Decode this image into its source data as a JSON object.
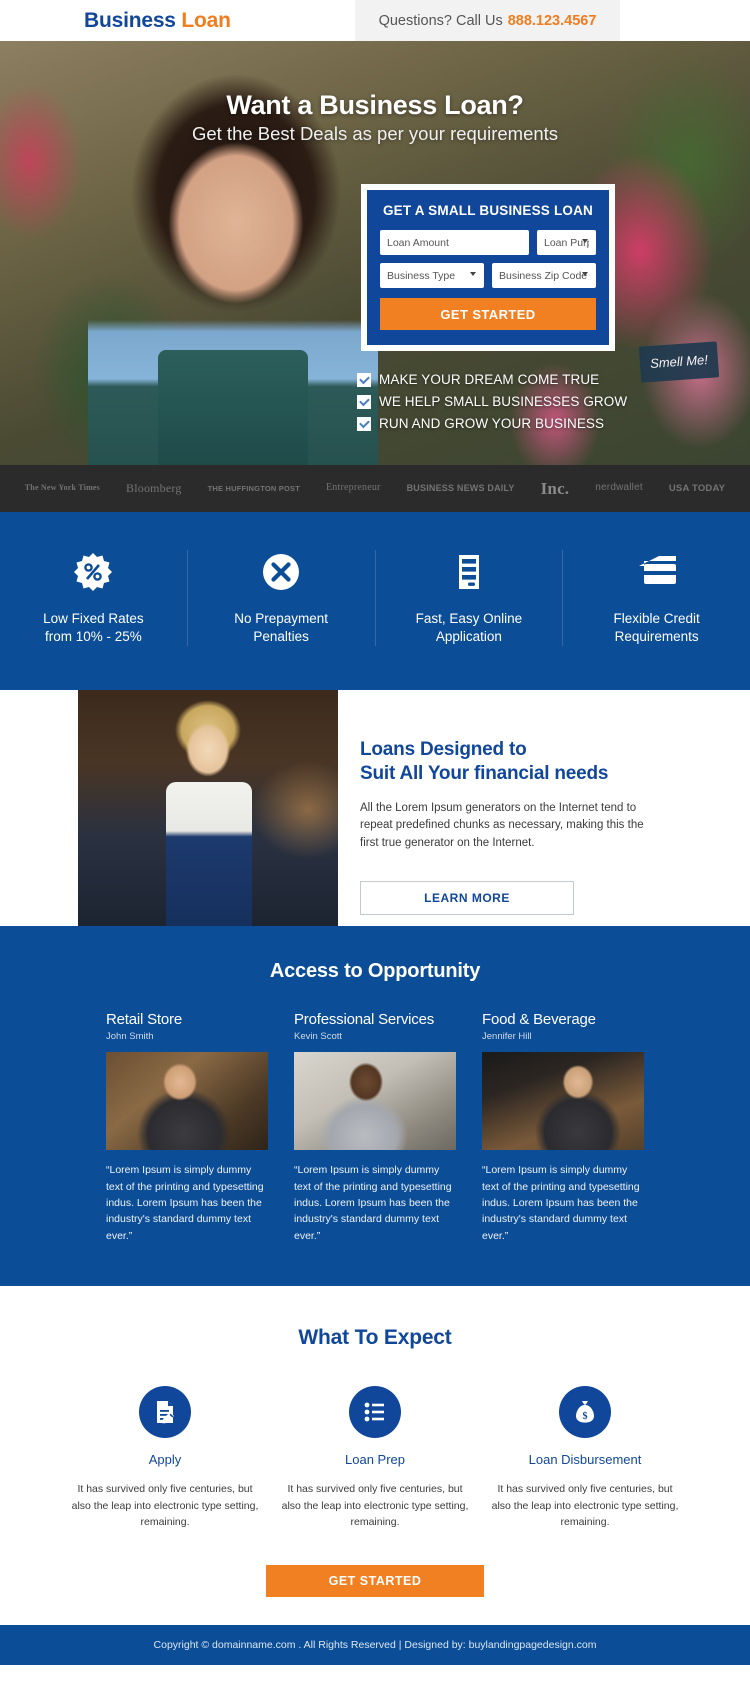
{
  "header": {
    "logo_primary": "Business",
    "logo_secondary": "Loan",
    "call_label": "Questions? Call Us",
    "phone": "888.123.4567"
  },
  "hero": {
    "title": "Want a Business Loan?",
    "subtitle": "Get the Best Deals as per your requirements",
    "sign_text": "Smell Me!",
    "form": {
      "title": "GET A SMALL BUSINESS LOAN",
      "loan_amount_placeholder": "Loan Amount",
      "loan_purpose_placeholder": "Loan Purpose",
      "business_type_placeholder": "Business Type",
      "zip_placeholder": "Business Zip Code",
      "submit_label": "GET STARTED"
    },
    "bullets": [
      "MAKE YOUR DREAM COME TRUE",
      "WE HELP SMALL BUSINESSES GROW",
      "RUN AND GROW YOUR BUSINESS"
    ]
  },
  "press": [
    "The New York Times",
    "Bloomberg",
    "THE HUFFINGTON POST",
    "Entrepreneur",
    "BUSINESS NEWS DAILY",
    "Inc.",
    "nerdwallet",
    "USA TODAY"
  ],
  "benefits": [
    {
      "icon": "percent-badge-icon",
      "label": "Low Fixed Rates\nfrom 10% - 25%",
      "line1": "Low Fixed Rates",
      "line2": "from 10% - 25%"
    },
    {
      "icon": "x-circle-icon",
      "label": "No Prepayment\nPenalties",
      "line1": "No Prepayment",
      "line2": "Penalties"
    },
    {
      "icon": "server-icon",
      "label": "Fast, Easy Online\nApplication",
      "line1": "Fast, Easy Online",
      "line2": "Application"
    },
    {
      "icon": "credit-card-icon",
      "label": "Flexible Credit\nRequirements",
      "line1": "Flexible Credit",
      "line2": "Requirements"
    }
  ],
  "designed": {
    "heading_line1": "Loans Designed to",
    "heading_line2": "Suit All Your financial needs",
    "paragraph": "All the Lorem Ipsum generators on the Internet tend to repeat predefined chunks as necessary, making this the first true generator on the Internet.",
    "cta_label": "LEARN MORE"
  },
  "opportunity": {
    "title": "Access to Opportunity",
    "cards": [
      {
        "category": "Retail Store",
        "person": "John Smith",
        "quote": "“Lorem Ipsum is simply dummy text of the printing and typesetting indus. Lorem Ipsum has been the industry's standard dummy text ever.”"
      },
      {
        "category": "Professional Services",
        "person": "Kevin Scott",
        "quote": "“Lorem Ipsum is simply dummy text of the printing and typesetting indus. Lorem Ipsum has been the industry's standard dummy text ever.”"
      },
      {
        "category": "Food & Beverage",
        "person": "Jennifer Hill",
        "quote": "“Lorem Ipsum is simply dummy text of the printing and typesetting indus. Lorem Ipsum has been the industry's standard dummy text ever.”"
      }
    ]
  },
  "expect": {
    "title": "What To Expect",
    "steps": [
      {
        "icon": "document-edit-icon",
        "name": "Apply",
        "text": "It has survived only five centuries, but also the leap into electronic type setting, remaining."
      },
      {
        "icon": "checklist-icon",
        "name": "Loan Prep",
        "text": "It has survived only five centuries, but also the leap into electronic type setting, remaining."
      },
      {
        "icon": "money-bag-icon",
        "name": "Loan Disbursement",
        "text": "It has survived only five centuries, but also the leap into electronic type setting, remaining."
      }
    ],
    "cta_label": "GET STARTED"
  },
  "footer": {
    "text": "Copyright © domainname.com . All Rights Reserved | Designed by: buylandingpagedesign.com"
  },
  "colors": {
    "brand_blue": "#11479a",
    "band_blue": "#0b4d96",
    "orange": "#f08022",
    "press_bar": "#2b2b2b"
  }
}
